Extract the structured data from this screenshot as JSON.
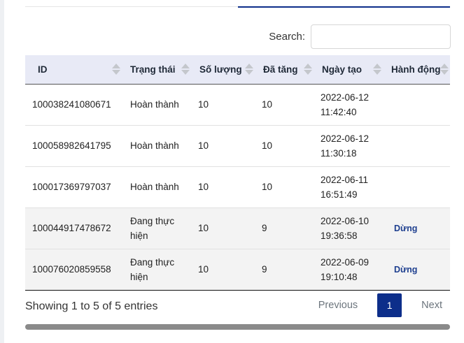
{
  "search": {
    "label": "Search:",
    "value": "",
    "placeholder": ""
  },
  "table": {
    "headers": [
      "ID",
      "Trạng thái",
      "Số lượng",
      "Đã tăng",
      "Ngày tạo",
      "Hành động"
    ],
    "rows": [
      {
        "id": "100038241080671",
        "status": "Hoàn thành",
        "quantity": "10",
        "increased": "10",
        "date": "2022-06-12",
        "time": "11:42:40",
        "action": ""
      },
      {
        "id": "100058982641795",
        "status": "Hoàn thành",
        "quantity": "10",
        "increased": "10",
        "date": "2022-06-12",
        "time": "11:30:18",
        "action": ""
      },
      {
        "id": "100017369797037",
        "status": "Hoàn thành",
        "quantity": "10",
        "increased": "10",
        "date": "2022-06-11",
        "time": "16:51:49",
        "action": ""
      },
      {
        "id": "100044917478672",
        "status": "Đang thực hiện",
        "quantity": "10",
        "increased": "9",
        "date": "2022-06-10",
        "time": "19:36:58",
        "action": "Dừng"
      },
      {
        "id": "100076020859558",
        "status": "Đang thực hiện",
        "quantity": "10",
        "increased": "9",
        "date": "2022-06-09",
        "time": "19:10:48",
        "action": "Dừng"
      }
    ]
  },
  "footer": {
    "info": "Showing 1 to 5 of 5 entries",
    "prev_label": "Previous",
    "current_page": "1",
    "next_label": "Next"
  },
  "colors": {
    "accent": "#0d2e8a",
    "header_bg": "#e8eaf6",
    "action_link": "#1e3f8f"
  }
}
